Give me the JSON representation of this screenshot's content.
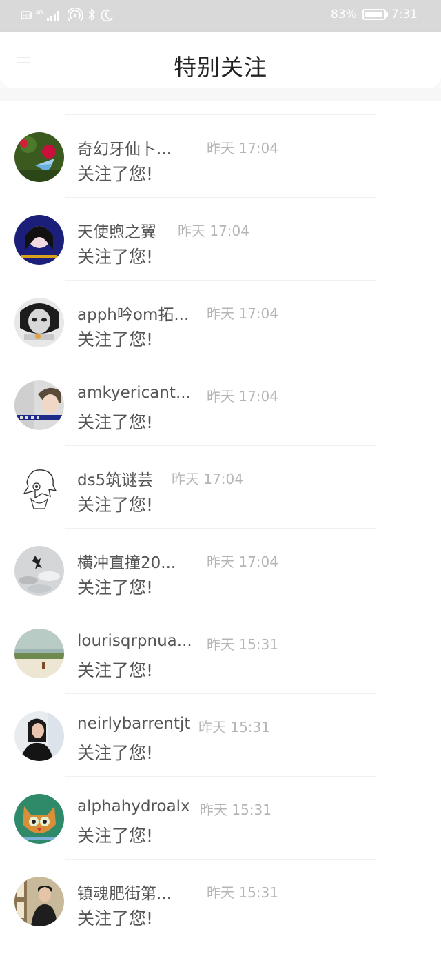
{
  "status_bar": {
    "left_label": "HD 4G",
    "battery": "83%",
    "battery_level": 0.83,
    "time": "7:31"
  },
  "header": {
    "title": "特别关注"
  },
  "notifications": [
    {
      "name": "奇幻牙仙卜...",
      "time": "昨天 17:04",
      "message": "关注了您!"
    },
    {
      "name": "天使煦之翼",
      "time": "昨天 17:04",
      "message": "关注了您!"
    },
    {
      "name": "apph吟om拓...",
      "time": "昨天 17:04",
      "message": "关注了您!"
    },
    {
      "name": "amkyericant...",
      "time": "昨天 17:04",
      "message": "关注了您!"
    },
    {
      "name": "ds5筑谜芸",
      "time": "昨天 17:04",
      "message": "关注了您!"
    },
    {
      "name": "横冲直撞20...",
      "time": "昨天 17:04",
      "message": "关注了您!"
    },
    {
      "name": "lourisqrpnua...",
      "time": "昨天 15:31",
      "message": "关注了您!"
    },
    {
      "name": "neirlybarrentjt",
      "time": "昨天 15:31",
      "message": "关注了您!"
    },
    {
      "name": "alphahydroalx",
      "time": "昨天 15:31",
      "message": "关注了您!"
    },
    {
      "name": "镇魂肥街第...",
      "time": "昨天 15:31",
      "message": "关注了您!"
    }
  ]
}
